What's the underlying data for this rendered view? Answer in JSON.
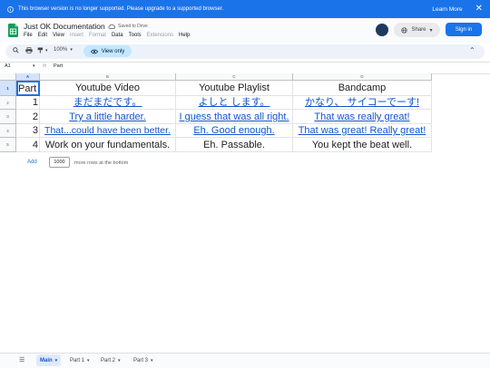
{
  "banner": {
    "message": "This browser version is no longer supported. Please upgrade to a supported browser.",
    "learn_more": "Learn More",
    "close": "✕"
  },
  "doc": {
    "title": "Just OK Documentation",
    "saved_status": "Saved to Drive"
  },
  "menu": [
    "File",
    "Edit",
    "View",
    "Insert",
    "Format",
    "Data",
    "Tools",
    "Extensions",
    "Help"
  ],
  "menu_disabled": [
    false,
    false,
    false,
    true,
    true,
    false,
    false,
    true,
    false
  ],
  "header_buttons": {
    "share": "Share",
    "sign_in": "Sign in"
  },
  "toolbar": {
    "zoom": "100%",
    "view_only": "View only"
  },
  "formula": {
    "cell_ref": "A1",
    "fx": "fx",
    "value": "Part"
  },
  "grid": {
    "columns": [
      "A",
      "B",
      "C",
      "D"
    ],
    "rows": [
      "1",
      "2",
      "3",
      "4",
      "5"
    ],
    "cells": [
      [
        "Part",
        "Youtube Video",
        "Youtube Playlist",
        "Bandcamp"
      ],
      [
        "1",
        "まだまだです。",
        "よしと します。",
        "かなり、  サイコーでーす!"
      ],
      [
        "2",
        "Try a little harder.",
        "I guess that was all right.",
        "That was really great!"
      ],
      [
        "3",
        "That...could have been better.",
        "Eh. Good enough.",
        "That was great! Really great!"
      ],
      [
        "4",
        "Work on your fundamentals.",
        "Eh. Passable.",
        "You kept the beat well."
      ]
    ]
  },
  "add_rows": {
    "add": "Add",
    "count": "1000",
    "suffix": "more rows at the bottom"
  },
  "sheets": {
    "tabs": [
      "Main",
      "Part 1",
      "Part 2",
      "Part 3"
    ],
    "active": "Main"
  },
  "colors": {
    "accent": "#1a73e8",
    "link": "#1155cc",
    "view_only_bg": "#c2e7ff"
  }
}
